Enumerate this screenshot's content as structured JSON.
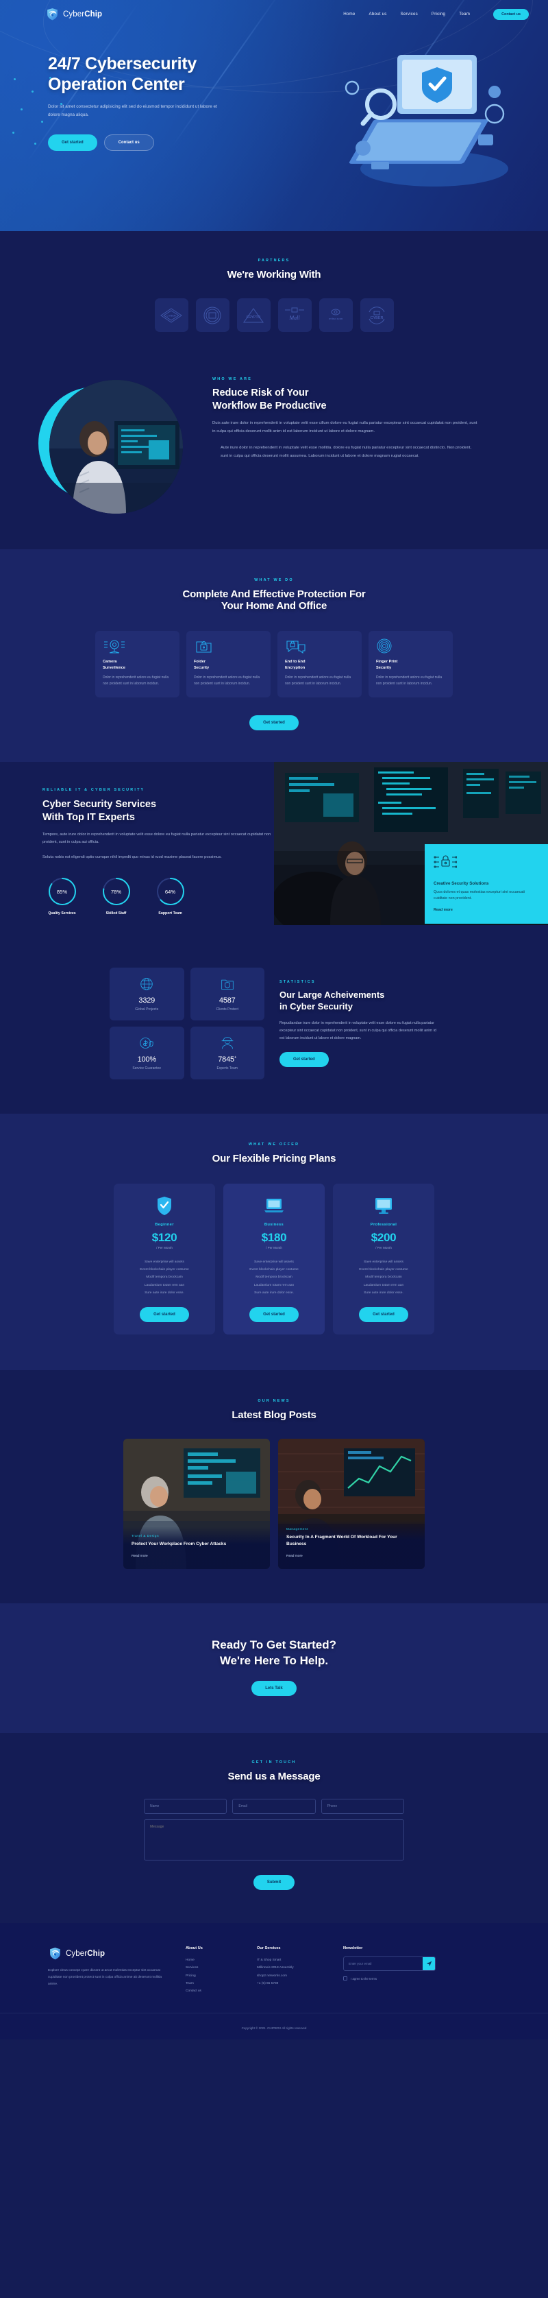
{
  "brand": {
    "name_light": "Cyber",
    "name_bold": "Chip"
  },
  "nav": {
    "links": [
      "Home",
      "About us",
      "Services",
      "Pricing",
      "Team"
    ],
    "cta_label": "Contact us"
  },
  "hero": {
    "title_line1": "24/7 Cybersecurity",
    "title_line2": "Operation Center",
    "paragraph": "Dolor sit amet consectetur adipisicing elit sed do eiusmod tempor incididunt ut labore et dolore magna aliqua.",
    "btn_primary": "Get started",
    "btn_secondary": "Contact us"
  },
  "partners": {
    "eyebrow": "PARTNERS",
    "title": "We're Working With",
    "logos": [
      "CYBER",
      "SECURE BADGE",
      "CRYPTO",
      "Mall",
      "retina scan",
      "CYBER"
    ]
  },
  "whoweare": {
    "eyebrow": "WHO WE ARE",
    "title_line1": "Reduce Risk of Your",
    "title_line2": "Workflow Be Productive",
    "p1": "Duis aute irure dolor in reprehenderit in voluptate velit esse cillum dolore eu fugiat nulla pariatur excepteur sint occaecat cupidatat non proident, sunt in culpa qui officia deserunt mollit anim id est laborum incidunt ut labore et dolore magnam.",
    "p2": "Aute irure dolor in reprehenderit in voluptate velit esse mollitia. dolore eu fugiat nulla pariatur excepteur sint occaecat distincto. Non proident, sunt in culpa qui officia deserunt mollit assumea. Laborum incidunt ut labore et dolore magnam rugiat occaecai."
  },
  "whatwedo": {
    "eyebrow": "WHAT WE DO",
    "title_line1": "Complete And Effective Protection For",
    "title_line2": "Your Home And Office",
    "cards": [
      {
        "icon": "camera-icon",
        "title": "Camera\nSurveillence",
        "desc": "Dolor in reprehenderit aolore eu fugiat nulla non proident sunt in laborum incidun."
      },
      {
        "icon": "folder-lock-icon",
        "title": "Folder\nSecurity",
        "desc": "Dolor in reprehenderit aolore eu fugiat nulla non proident sunt in laborum incidun."
      },
      {
        "icon": "chat-lock-icon",
        "title": "End to End\nEncryption",
        "desc": "Dolor in reprehenderit aolore eu fugiat nulla non proident sunt in laborum incidun."
      },
      {
        "icon": "fingerprint-icon",
        "title": "Finger Print\nSecurity",
        "desc": "Dolor in reprehenderit aolore eu fugiat nulla non proident sunt in laborum incidun."
      }
    ],
    "button": "Get started"
  },
  "reliable": {
    "eyebrow": "RELIABLE IT & CYBER SECURITY",
    "title_line1": "Cyber Security Services",
    "title_line2": "With Top IT Experts",
    "p1": "Tempore, aute irure dolor in reprehenderit in voluptate velit esse dolore eu fugiat nulla pariatur excepteur sint occaecat cupidatat non proident, sunt in culpa aui officia.",
    "p2": "Soluta nobis est eligendi optio cumque nihil impedit quo minus id ruod maxime placeat facere possimus.",
    "stats": [
      {
        "value": "85%",
        "label": "Quality Services",
        "pct": 85
      },
      {
        "value": "78%",
        "label": "Skilled Staff",
        "pct": 78
      },
      {
        "value": "64%",
        "label": "Support Team",
        "pct": 64
      }
    ],
    "card": {
      "title": "Creative Security Solutions",
      "desc": "Quos dolores et quas molestias excepturi sint occaecati cuiditate non provident.",
      "link": "Read more"
    }
  },
  "statistics": {
    "eyebrow": "STATISTICS",
    "title_line1": "Our Large Acheivements",
    "title_line2": "in Cyber Security",
    "paragraph": "Repudiandae irure dolor in reprehenderit in voluptate velit esse dolore eu fugiat nulla pariatur excepteur sint occaecat cupidatat non proident, sunt in culpa qui officia deserunt mollit anim id est laborum incidunt ut labore et dolore magnam.",
    "button": "Get started",
    "cards": [
      {
        "icon": "globe-icon",
        "value": "3329",
        "sup": "",
        "label": "Global Projects"
      },
      {
        "icon": "folder-shield-icon",
        "value": "4587",
        "sup": "",
        "label": "Clients Protect"
      },
      {
        "icon": "money-shield-icon",
        "value": "100%",
        "sup": "",
        "label": "Service Guarantee"
      },
      {
        "icon": "hacker-icon",
        "value": "7845",
        "sup": "+",
        "label": "Experts Team"
      }
    ]
  },
  "pricing": {
    "eyebrow": "WHAT WE OFFER",
    "title": "Our Flexible Pricing Plans",
    "plans": [
      {
        "icon": "shield-icon",
        "name": "Beginner",
        "price": "$120",
        "period": "/ Per Month",
        "features": [
          "Save enterprise will assets",
          "Event blockchain player costume",
          "Modif tempora brockcain",
          "Laudantium totam rem aan",
          "Sure aute irure dolor esse."
        ],
        "button": "Get started"
      },
      {
        "icon": "laptop-icon",
        "name": "Business",
        "price": "$180",
        "period": "/ Per Month",
        "features": [
          "Save enterprise will assets",
          "Event blockchain player costume",
          "Modif tempora brockcain",
          "Laudantium totam rem aan",
          "Sure aute irure dolor esse."
        ],
        "button": "Get started"
      },
      {
        "icon": "monitor-icon",
        "name": "Professional",
        "price": "$200",
        "period": "/ Per Month",
        "features": [
          "Save enterprise will assets",
          "Event blockchain player costume",
          "Modif tempora brockcain",
          "Laudantium totam rem aan",
          "Sure aute irure dolor esse."
        ],
        "button": "Get started"
      }
    ]
  },
  "blog": {
    "eyebrow": "OUR NEWS",
    "title": "Latest Blog Posts",
    "posts": [
      {
        "category": "Travel & Design",
        "title": "Protect Your Workplace From Cyber Attacks",
        "link": "Read more"
      },
      {
        "category": "Management",
        "title": "Security In A Fragment World Of Workload For Your Business",
        "link": "Read more"
      }
    ]
  },
  "cta": {
    "title_line1": "Ready To Get Started?",
    "title_line2": "We're Here To Help.",
    "button": "Lets Talk"
  },
  "contact": {
    "eyebrow": "GET IN TOUCH",
    "title": "Send us a Message",
    "fields": {
      "name_placeholder": "Name",
      "email_placeholder": "Email",
      "phone_placeholder": "Phone",
      "message_placeholder": "Message"
    },
    "button": "Submit"
  },
  "footer": {
    "about_text": "Explore cleus concept cyare diorant ut arcut molestias exceptur sint occaecat cupiditate non provident protect sunt in culpa officia anime ait deserunt mollitia anime.",
    "col_about": {
      "heading": "About Us",
      "items": [
        "Home",
        "Services",
        "Pricing",
        "Team",
        "Contact us"
      ]
    },
    "col_services": {
      "heading": "Our Services",
      "items": [
        "IT & Shop Smart",
        "Millinneis 2018 Assembly",
        "shop2 networks.com",
        "+1 (5) 65 5789"
      ]
    },
    "newsletter": {
      "heading": "Newsletter",
      "placeholder": "Enter your email",
      "consent": "I agree to the terms"
    },
    "copyright": "Copyright © 2021. CHIPBOX All rights reserved"
  },
  "colors": {
    "accent": "#22d3ee",
    "bg_dark": "#141c55",
    "bg_alt": "#1b2566",
    "card": "#222d73",
    "hero_blue": "#1d58ad"
  }
}
